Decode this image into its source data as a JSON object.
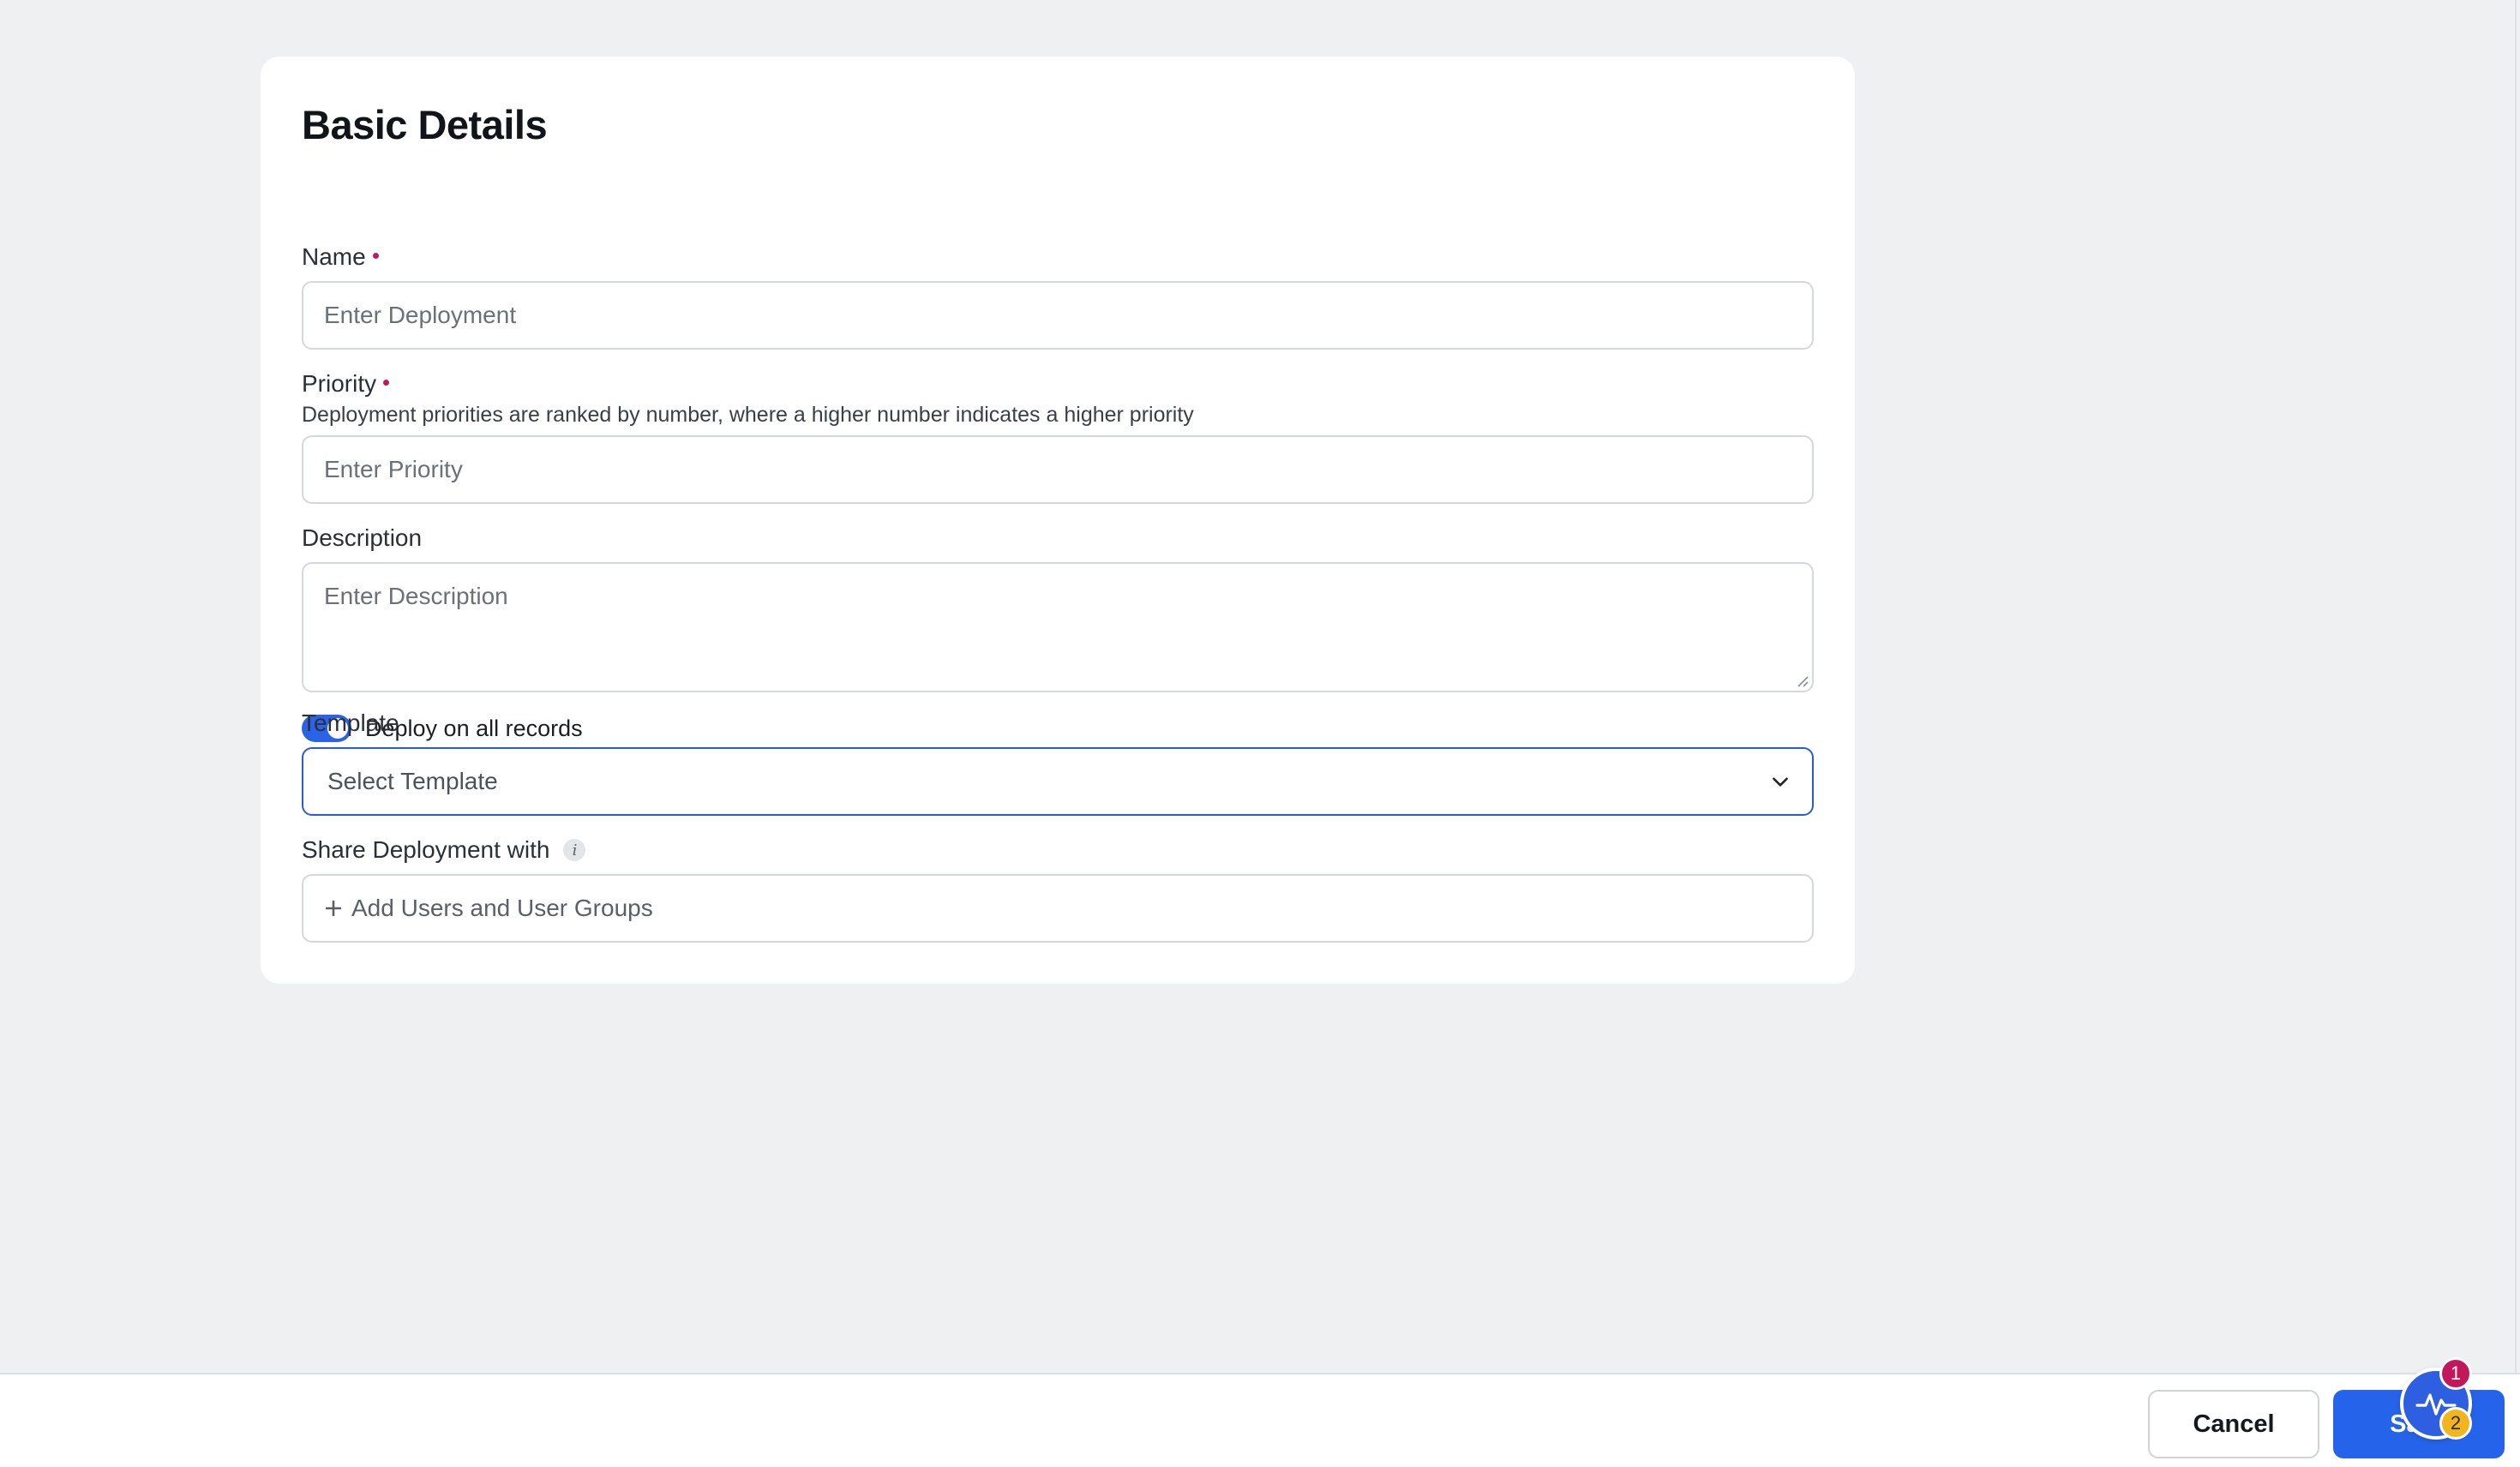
{
  "card": {
    "title": "Basic Details"
  },
  "fields": {
    "name": {
      "label": "Name",
      "placeholder": "Enter Deployment",
      "required": true
    },
    "priority": {
      "label": "Priority",
      "helper": "Deployment priorities are ranked by number, where a higher number indicates a higher priority",
      "placeholder": "Enter Priority",
      "required": true
    },
    "description": {
      "label": "Description",
      "placeholder": "Enter Description"
    },
    "deploy_toggle": {
      "label": "Deploy on all records",
      "on": true
    },
    "template": {
      "label": "Template",
      "placeholder": "Select Template"
    },
    "share": {
      "label": "Share Deployment with",
      "add_label": "Add Users and User Groups"
    }
  },
  "footer": {
    "cancel_label": "Cancel",
    "save_label": "Save"
  },
  "fab": {
    "badge_top": "1",
    "badge_bottom": "2"
  },
  "colors": {
    "accent": "#2563eb",
    "required": "#c2185b",
    "badge_warning": "#f2b51d"
  }
}
